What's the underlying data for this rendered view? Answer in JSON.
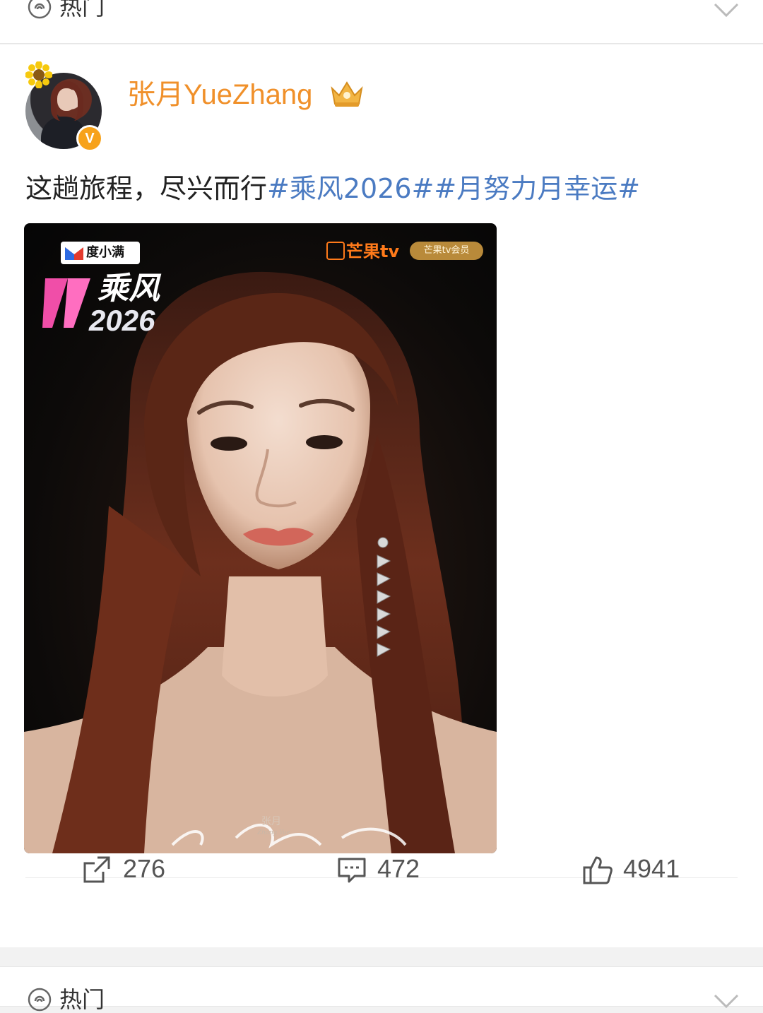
{
  "hot_bar": {
    "label": "热门"
  },
  "post": {
    "username": "张月YueZhang",
    "verified_mark": "V",
    "text_plain": "这趟旅程，尽兴而行",
    "hashtags": [
      "#乘风2026#",
      "#月努力月幸运#"
    ],
    "poster": {
      "sponsor_logo": "度小满",
      "show_title": "乘风",
      "show_year": "2026",
      "platform_logo": "芒果tv",
      "vip_badge": "芒果tv会员",
      "signature_name": "张月",
      "signature_pinyin": "Zhang Yue"
    },
    "actions": {
      "repost_count": "276",
      "comment_count": "472",
      "like_count": "4941"
    }
  },
  "colors": {
    "username": "#f0902a",
    "hashtag": "#4b7bc2",
    "badge": "#f7a21b",
    "action_icon": "#555555"
  }
}
